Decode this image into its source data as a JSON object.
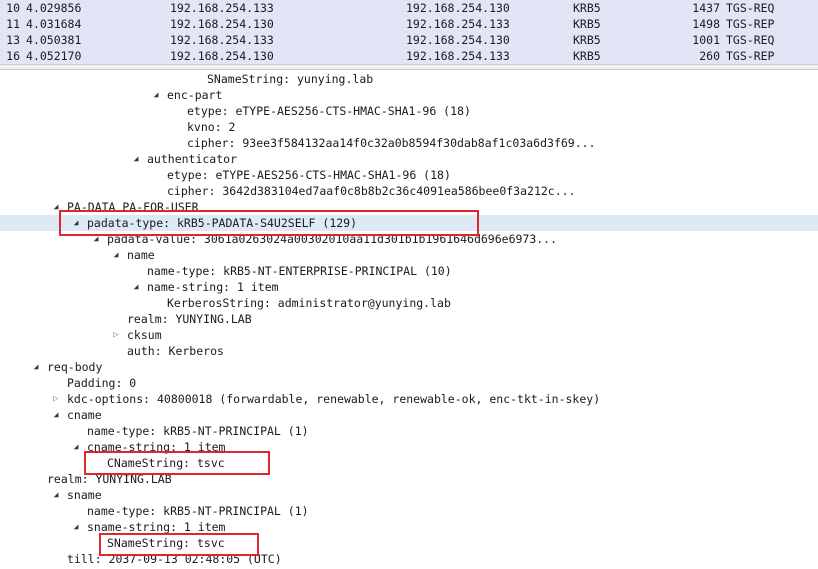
{
  "packets": [
    {
      "no": "10",
      "time": "4.029856",
      "src": "192.168.254.133",
      "dst": "192.168.254.130",
      "proto": "KRB5",
      "len": "1437",
      "info": "TGS-REQ"
    },
    {
      "no": "11",
      "time": "4.031684",
      "src": "192.168.254.130",
      "dst": "192.168.254.133",
      "proto": "KRB5",
      "len": "1498",
      "info": "TGS-REP"
    },
    {
      "no": "13",
      "time": "4.050381",
      "src": "192.168.254.133",
      "dst": "192.168.254.130",
      "proto": "KRB5",
      "len": "1001",
      "info": "TGS-REQ"
    },
    {
      "no": "16",
      "time": "4.052170",
      "src": "192.168.254.130",
      "dst": "192.168.254.133",
      "proto": "KRB5",
      "len": "260",
      "info": "TGS-REP"
    }
  ],
  "tree": {
    "sname_string_top": "SNameString: yunying.lab",
    "enc_part": "enc-part",
    "enc_part_etype": "etype: eTYPE-AES256-CTS-HMAC-SHA1-96 (18)",
    "enc_part_kvno": "kvno: 2",
    "enc_part_cipher": "cipher: 93ee3f584132aa14f0c32a0b8594f30dab8af1c03a6d3f69...",
    "authenticator": "authenticator",
    "auth_etype": "etype: eTYPE-AES256-CTS-HMAC-SHA1-96 (18)",
    "auth_cipher": "cipher: 3642d383104ed7aaf0c8b8b2c36c4091ea586bee0f3a212c...",
    "pa_data": "PA-DATA PA-FOR-USER",
    "padata_type": "padata-type: kRB5-PADATA-S4U2SELF (129)",
    "padata_value": "padata-value: 3061a0263024a00302010aa11d301b1b1961646d696e6973...",
    "name": "name",
    "name_type_principal": "name-type: kRB5-NT-ENTERPRISE-PRINCIPAL (10)",
    "name_string_item": "name-string: 1 item",
    "kerberos_string": "KerberosString: administrator@yunying.lab",
    "realm_upper": "realm: YUNYING.LAB",
    "cksum": "cksum",
    "auth_kerberos": "auth: Kerberos",
    "req_body": "req-body",
    "padding": "Padding: 0",
    "kdc_options": "kdc-options: 40800018 (forwardable, renewable, renewable-ok, enc-tkt-in-skey)",
    "cname": "cname",
    "cname_name_type": "name-type: kRB5-NT-PRINCIPAL (1)",
    "cname_string": "cname-string: 1 item",
    "cname_string_value": "CNameString: tsvc",
    "realm_body": "realm: YUNYING.LAB",
    "sname": "sname",
    "sname_name_type": "name-type: kRB5-NT-PRINCIPAL (1)",
    "sname_string": "sname-string: 1 item",
    "sname_string_value": "SNameString: tsvc",
    "till": "till: 2037-09-13 02:48:05 (UTC)"
  },
  "colors": {
    "packet_row_bg": "#e4e4f7",
    "selected_row_bg": "#ddeaf6",
    "highlight_border": "#e0262d"
  },
  "icons": {
    "expanded": "expanded-triangle-icon",
    "collapsed": "collapsed-triangle-icon"
  }
}
